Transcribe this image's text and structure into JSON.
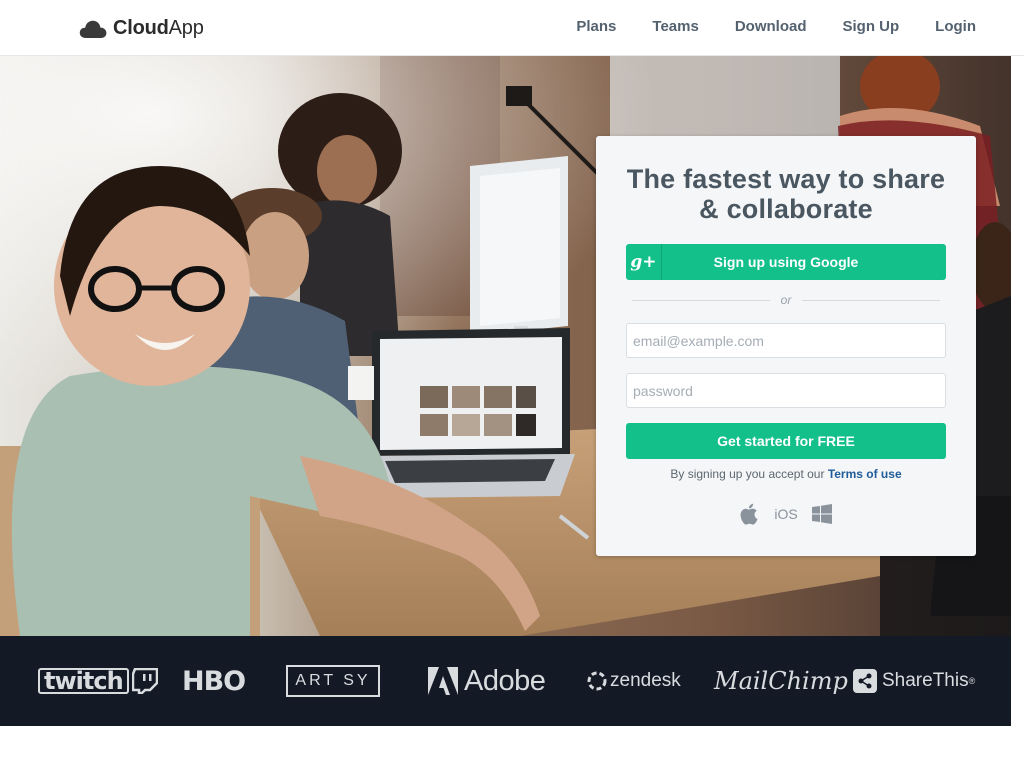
{
  "header": {
    "logo_text_bold": "Cloud",
    "logo_text_regular": "App",
    "nav": [
      {
        "label": "Plans"
      },
      {
        "label": "Teams"
      },
      {
        "label": "Download"
      },
      {
        "label": "Sign Up"
      },
      {
        "label": "Login"
      }
    ]
  },
  "signup": {
    "title_line1": "The fastest way to share",
    "title_line2": "& collaborate",
    "google_icon": "g+",
    "google_label": "Sign up using Google",
    "or": "or",
    "email_placeholder": "email@example.com",
    "password_placeholder": "password",
    "cta_label": "Get started for FREE",
    "terms_prefix": "By signing up you accept our ",
    "terms_link": "Terms of use",
    "platform_ios": "iOS",
    "platform_icons": [
      "apple-icon",
      "windows-icon"
    ]
  },
  "brands": {
    "twitch_a": "twitch",
    "hbo": "HBO",
    "artsy": "ART SY",
    "adobe": "Adobe",
    "zendesk": "zendesk",
    "mailchimp": "MailChimp",
    "sharethis": "ShareThis",
    "trademark": "®"
  },
  "colors": {
    "accent_green": "#13c08a",
    "nav_text": "#546270",
    "logos_bar": "#141926",
    "link_blue": "#1f5c99"
  }
}
